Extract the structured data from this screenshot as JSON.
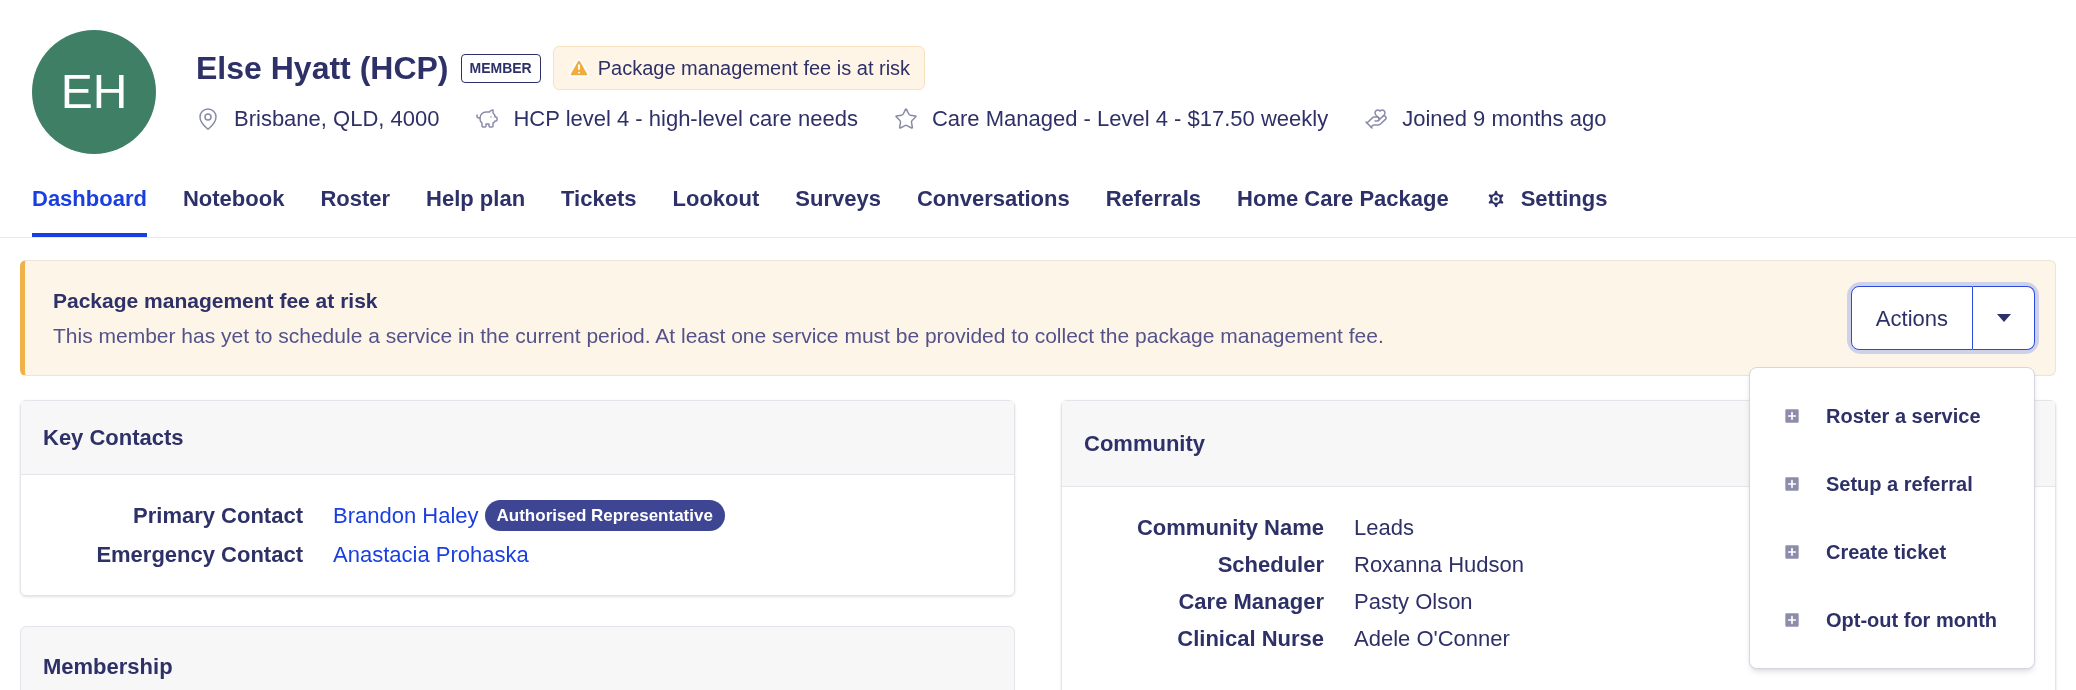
{
  "profile": {
    "initials": "EH",
    "name": "Else Hyatt (HCP)",
    "badge": "MEMBER",
    "warning": "Package management fee is at risk",
    "meta": [
      {
        "kind": "location",
        "text": "Brisbane, QLD, 4000"
      },
      {
        "kind": "piggy",
        "text": "HCP level 4 - high-level care needs"
      },
      {
        "kind": "star",
        "text": "Care Managed - Level 4 - $17.50 weekly"
      },
      {
        "kind": "hand",
        "text": "Joined 9 months ago"
      }
    ]
  },
  "tabs": [
    {
      "label": "Dashboard",
      "selected": true,
      "kind": "plain"
    },
    {
      "label": "Notebook",
      "selected": false,
      "kind": "plain"
    },
    {
      "label": "Roster",
      "selected": false,
      "kind": "plain"
    },
    {
      "label": "Help plan",
      "selected": false,
      "kind": "plain"
    },
    {
      "label": "Tickets",
      "selected": false,
      "kind": "plain"
    },
    {
      "label": "Lookout",
      "selected": false,
      "kind": "plain"
    },
    {
      "label": "Surveys",
      "selected": false,
      "kind": "plain"
    },
    {
      "label": "Conversations",
      "selected": false,
      "kind": "plain"
    },
    {
      "label": "Referrals",
      "selected": false,
      "kind": "plain"
    },
    {
      "label": "Home Care Package",
      "selected": false,
      "kind": "plain"
    },
    {
      "label": "Settings",
      "selected": false,
      "kind": "gear"
    }
  ],
  "alert": {
    "title": "Package management fee at risk",
    "message": "This member has yet to schedule a service in the current period. At least one service must be provided to collect the package management fee.",
    "button": "Actions",
    "expanded": true,
    "menu": [
      "Roster a service",
      "Setup a referral",
      "Create ticket",
      "Opt-out for month"
    ]
  },
  "key_contacts": {
    "title": "Key Contacts",
    "rows": [
      {
        "label": "Primary Contact",
        "value": "Brandon Haley",
        "tag": "Authorised Representative"
      },
      {
        "label": "Emergency Contact",
        "value": "Anastacia Prohaska"
      }
    ]
  },
  "membership": {
    "title": "Membership"
  },
  "community": {
    "title": "Community",
    "rows": [
      {
        "label": "Community Name",
        "value": "Leads"
      },
      {
        "label": "Scheduler",
        "value": "Roxanna Hudson"
      },
      {
        "label": "Care Manager",
        "value": "Pasty Olson"
      },
      {
        "label": "Clinical Nurse",
        "value": "Adele O'Conner"
      }
    ]
  }
}
